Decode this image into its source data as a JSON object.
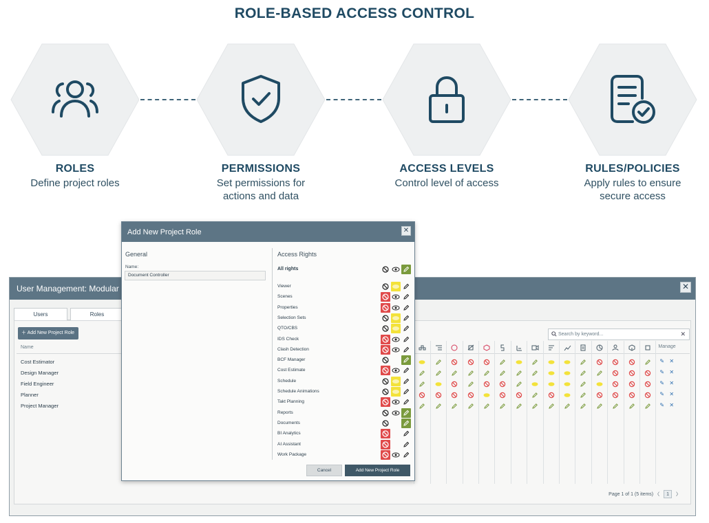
{
  "title": "ROLE-BASED ACCESS CONTROL",
  "steps": [
    {
      "title": "ROLES",
      "desc": "Define project roles",
      "icon": "users-icon"
    },
    {
      "title": "PERMISSIONS",
      "desc": "Set permissions for actions and data",
      "icon": "shield-check-icon"
    },
    {
      "title": "ACCESS LEVELS",
      "desc": "Control level of access",
      "icon": "lock-icon"
    },
    {
      "title": "RULES/POLICIES",
      "desc": "Apply rules to ensure secure access",
      "icon": "document-check-icon"
    }
  ],
  "colors": {
    "dark": "#1f4a63",
    "hex_fill": "#eef0f1",
    "header": "#5d7585",
    "deny": "#e04a4a",
    "view": "#f3e23a",
    "edit": "#7a9a3c"
  },
  "user_management": {
    "title": "User Management: Modular Hou",
    "close": "✕",
    "tabs": [
      "Users",
      "Roles"
    ],
    "add_role_label": "Add New Project Role",
    "name_header": "Name",
    "roles": [
      "Cost Estimator",
      "Design Manager",
      "Field Engineer",
      "Planner",
      "Project Manager"
    ],
    "search_placeholder": "Search by keyword...",
    "manage_label": "Manage",
    "pager_text": "Page 1 of 1 (5 items)",
    "page_number": "1",
    "grid": [
      [
        "v",
        "v",
        "e",
        "d",
        "d",
        "d",
        "e",
        "v",
        "e",
        "v",
        "v",
        "e",
        "d",
        "d",
        "d",
        "e"
      ],
      [
        "e",
        "e",
        "e",
        "e",
        "e",
        "e",
        "e",
        "e",
        "e",
        "v",
        "v",
        "e",
        "e",
        "d",
        "d",
        "d"
      ],
      [
        "v",
        "e",
        "v",
        "d",
        "e",
        "d",
        "d",
        "e",
        "v",
        "v",
        "v",
        "e",
        "v",
        "d",
        "d",
        "d"
      ],
      [
        "e",
        "d",
        "d",
        "d",
        "d",
        "v",
        "d",
        "d",
        "e",
        "d",
        "v",
        "e",
        "d",
        "d",
        "d",
        "d"
      ],
      [
        "e",
        "e",
        "e",
        "e",
        "e",
        "e",
        "e",
        "e",
        "e",
        "e",
        "e",
        "e",
        "e",
        "e",
        "e",
        "e"
      ]
    ]
  },
  "dialog": {
    "title": "Add New Project Role",
    "close": "✕",
    "general_title": "General",
    "name_label": "Name:",
    "name_value": "Document Controller",
    "access_rights_title": "Access Rights",
    "all_rights_label": "All rights",
    "rights": [
      {
        "label": "Viewer",
        "state": "view"
      },
      {
        "label": "Scenes",
        "state": "deny"
      },
      {
        "label": "Properties",
        "state": "deny"
      },
      {
        "label": "Selection Sets",
        "state": "view"
      },
      {
        "label": "QTO/CBS",
        "state": "view"
      },
      {
        "label": "IDS Check",
        "state": "deny"
      },
      {
        "label": "Clash Detection",
        "state": "deny"
      },
      {
        "label": "BCF Manager",
        "state": "edit-only"
      },
      {
        "label": "Cost Estimate",
        "state": "deny"
      },
      {
        "label": "Schedule",
        "state": "view"
      },
      {
        "label": "Schedule Animations",
        "state": "view"
      },
      {
        "label": "Takt Planning",
        "state": "deny"
      },
      {
        "label": "Reports",
        "state": "edit"
      },
      {
        "label": "Documents",
        "state": "edit-noview"
      },
      {
        "label": "BI Analytics",
        "state": "deny-noview"
      },
      {
        "label": "AI Assistant",
        "state": "deny-noview"
      },
      {
        "label": "Work Package",
        "state": "deny"
      }
    ],
    "cancel_label": "Cancel",
    "add_label": "Add New Project Role"
  }
}
